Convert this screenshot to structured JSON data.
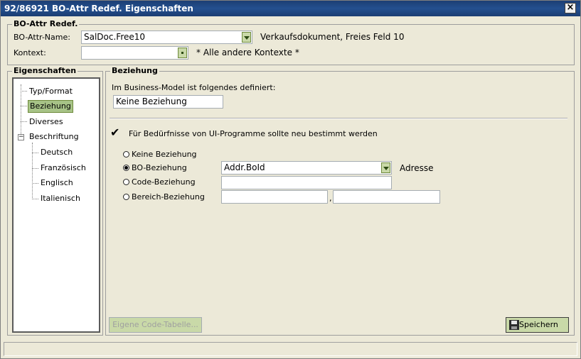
{
  "window": {
    "title": "92/86921 BO-Attr Redef. Eigenschaften",
    "close_label": "×"
  },
  "attr_group": {
    "title": "BO-Attr Redef.",
    "name_label": "BO-Attr-Name:",
    "name_value": "SalDoc.Free10",
    "name_description": "Verkaufsdokument, Freies Feld 10",
    "context_label": "Kontext:",
    "context_value": "",
    "context_description": "* Alle andere Kontexte *"
  },
  "properties": {
    "title": "Eigenschaften",
    "items": [
      {
        "label": "Typ/Format"
      },
      {
        "label": "Beziehung",
        "selected": true
      },
      {
        "label": "Diverses"
      },
      {
        "label": "Beschriftung",
        "expanded": true
      },
      {
        "label": "Deutsch"
      },
      {
        "label": "Französisch"
      },
      {
        "label": "Englisch"
      },
      {
        "label": "Italienisch"
      }
    ],
    "expander_symbol": "−"
  },
  "relation": {
    "title": "Beziehung",
    "business_model_label": "Im Business-Model ist folgendes definiert:",
    "business_model_value": "Keine Beziehung",
    "override_label": "Für Bedürfnisse von UI-Programme sollte neu bestimmt werden",
    "override_checked": true,
    "check_symbol": "✔",
    "options": [
      {
        "label": "Keine Beziehung",
        "selected": false
      },
      {
        "label": "BO-Beziehung",
        "selected": true
      },
      {
        "label": "Code-Beziehung",
        "selected": false
      },
      {
        "label": "Bereich-Beziehung",
        "selected": false
      }
    ],
    "bo_value": "Addr.BoId",
    "bo_description": "Adresse",
    "code_value": "",
    "range_from": "",
    "range_separator": ",",
    "range_to": ""
  },
  "buttons": {
    "code_table_label": "Eigene Code-Tabelle...",
    "save_label": "Speichern"
  },
  "status_text": ""
}
